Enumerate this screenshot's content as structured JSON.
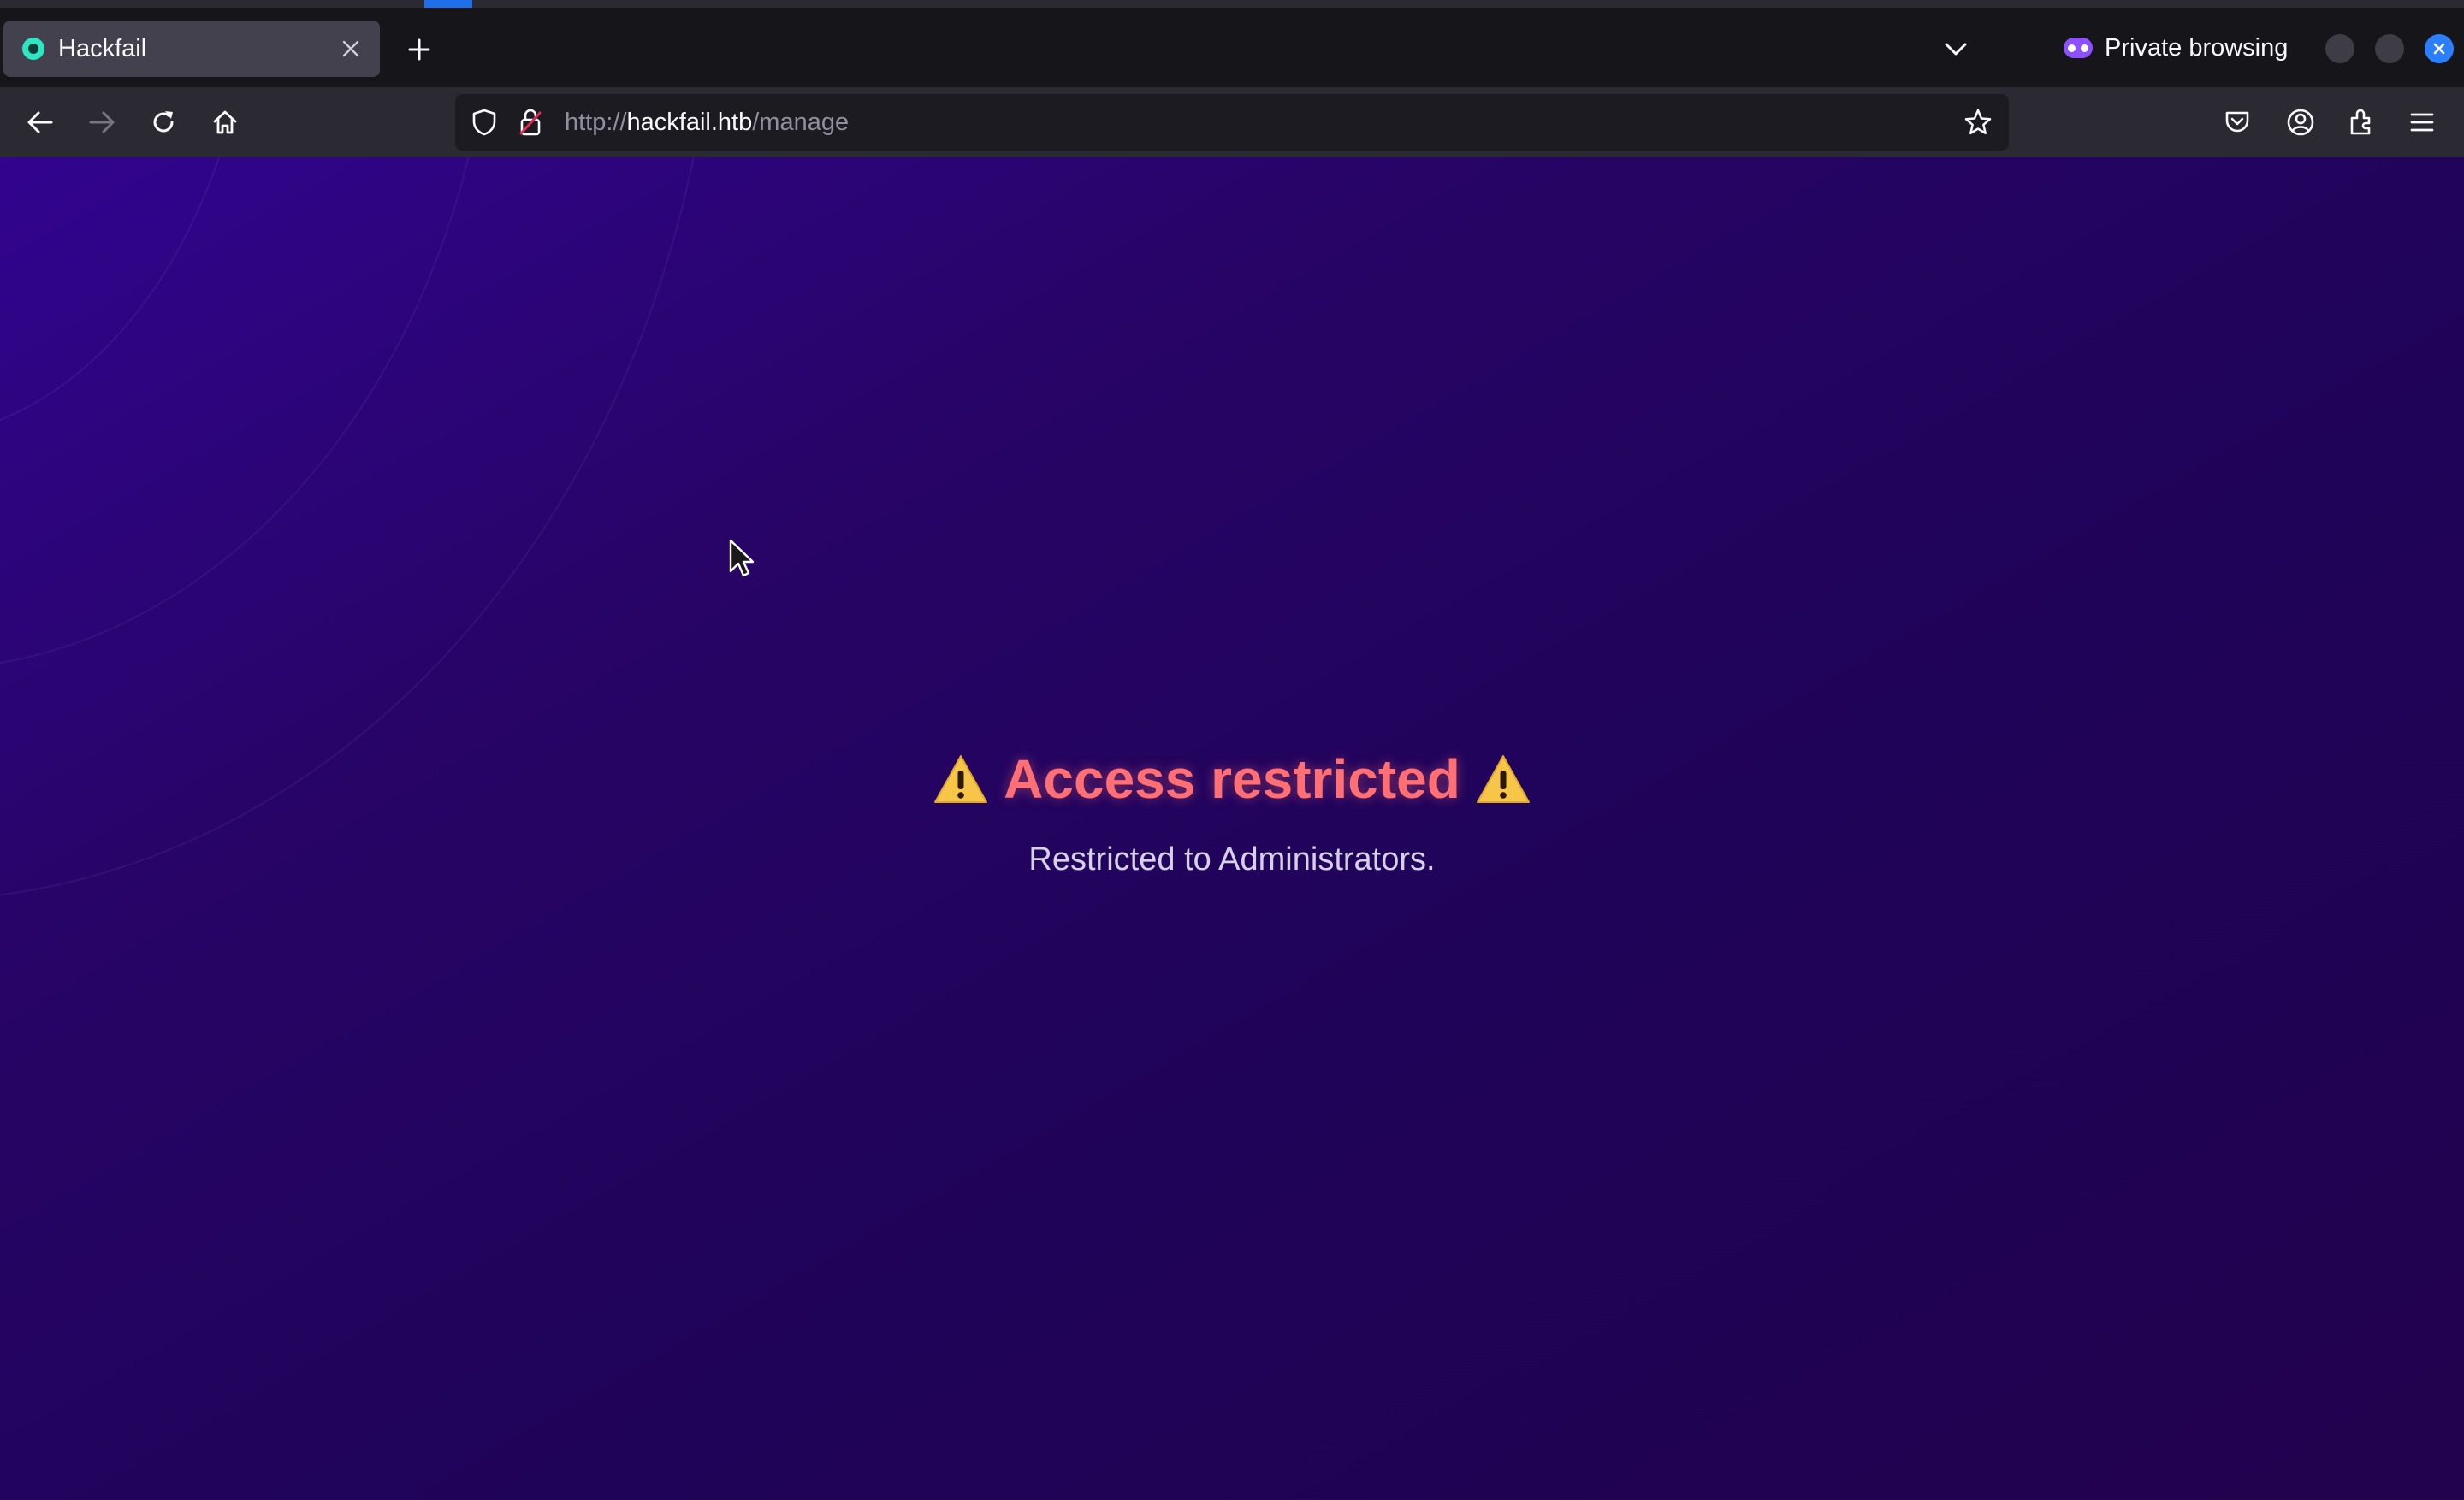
{
  "browser": {
    "tab": {
      "title": "Hackfail"
    },
    "private_label": "Private browsing",
    "url": {
      "scheme": "http://",
      "host": "hackfail.htb",
      "path": "/manage"
    }
  },
  "page": {
    "heading": "Access restricted",
    "subtext": "Restricted to Administrators.",
    "heading_color": "#ff6f74",
    "background_color": "#27045f"
  },
  "icons": {
    "tab_favicon": "globe-dot-icon",
    "tab_close": "close-icon",
    "new_tab": "plus-icon",
    "list_all_tabs": "chevron-down-icon",
    "private_browsing": "private-mask-icon",
    "back": "arrow-left-icon",
    "forward": "arrow-right-icon",
    "reload": "reload-icon",
    "home": "home-icon",
    "tracking_protection": "shield-icon",
    "connection": "lock-insecure-icon",
    "bookmark": "star-icon",
    "pocket": "pocket-icon",
    "account": "account-icon",
    "extensions": "puzzle-icon",
    "menu": "hamburger-menu-icon",
    "warning": "warning-triangle-icon"
  }
}
